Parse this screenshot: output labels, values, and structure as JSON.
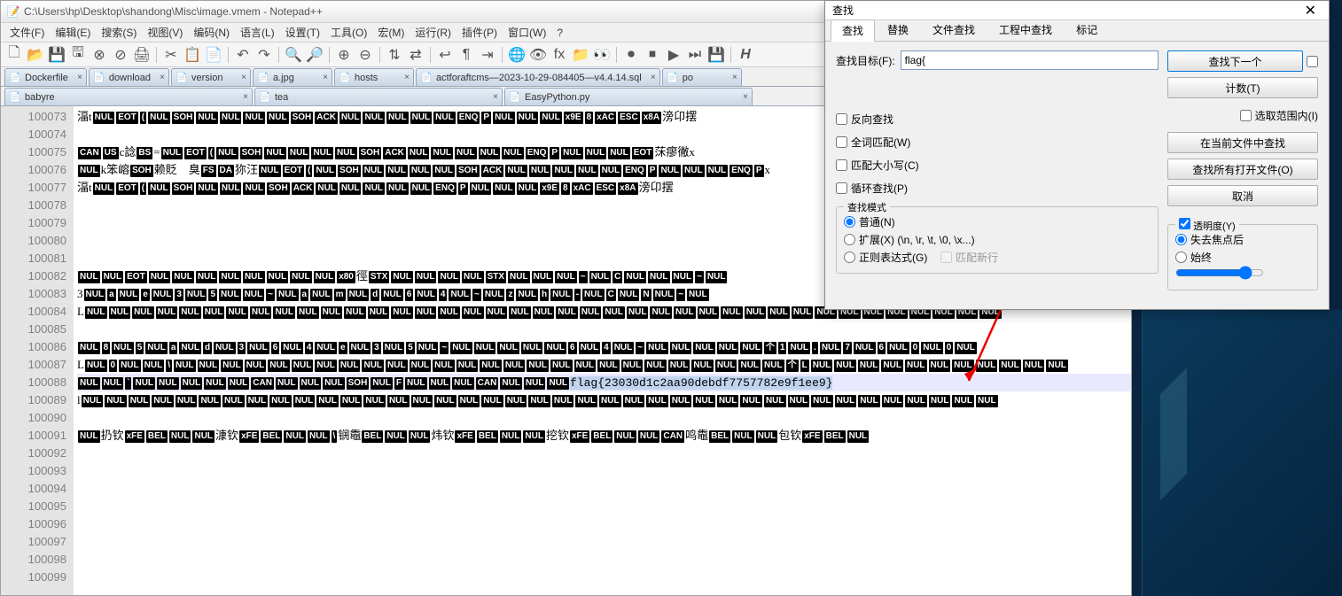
{
  "window": {
    "title": "C:\\Users\\hp\\Desktop\\shandong\\Misc\\image.vmem - Notepad++"
  },
  "menu": {
    "file": "文件(F)",
    "edit": "编辑(E)",
    "search": "搜索(S)",
    "view": "视图(V)",
    "encoding": "编码(N)",
    "language": "语言(L)",
    "settings": "设置(T)",
    "tools": "工具(O)",
    "macro": "宏(M)",
    "run": "运行(R)",
    "plugins": "插件(P)",
    "window": "窗口(W)",
    "help": "?"
  },
  "tabs1": [
    {
      "label": "Dockerfile"
    },
    {
      "label": "download"
    },
    {
      "label": "version"
    },
    {
      "label": "a.jpg"
    },
    {
      "label": "hosts"
    },
    {
      "label": "actforaftcms—2023-10-29-084405—v4.4.14.sql"
    },
    {
      "label": "po"
    }
  ],
  "tabs2": [
    {
      "label": "babyre"
    },
    {
      "label": "tea"
    },
    {
      "label": "EasyPython.py"
    }
  ],
  "gutter_start": 100073,
  "gutter_count": 27,
  "content_lines": {
    "0": {
      "pre": "湢t",
      "ctl": [
        "NUL",
        "EOT",
        "(",
        "NUL",
        "SOH",
        "NUL",
        "NUL",
        "NUL",
        "NUL",
        "SOH",
        "ACK",
        "NUL",
        "NUL",
        "NUL",
        "NUL",
        "NUL",
        "ENQ",
        "P",
        "NUL",
        "NUL",
        "NUL"
      ],
      "post": "滂",
      "ctl2": [
        "x9E",
        "8"
      ],
      "post2": "卬摆",
      "ctl3": [
        "xAC",
        "ESC",
        "x8A"
      ]
    },
    "2": {
      "pre": "",
      "ctl": [
        "CAN",
        "US"
      ],
      "mid": "c諗",
      "ctl2": [
        "BS"
      ],
      "mid2": "=",
      "ctl3": [
        "NUL",
        "EOT",
        "(",
        "NUL",
        "SOH",
        "NUL",
        "NUL",
        "NUL",
        "NUL",
        "SOH",
        "ACK",
        "NUL",
        "NUL",
        "NUL",
        "NUL",
        "NUL",
        "ENQ",
        "P",
        "NUL",
        "NUL",
        "NUL",
        "EOT"
      ],
      "post": "莯瘳徶x"
    },
    "3": {
      "pre": "",
      "ctl": [
        "NUL"
      ],
      "mid": "k笨嵱",
      "ctl2": [
        "SOH"
      ],
      "mid2": "赖貶　臭",
      "ctl3": [
        "FS",
        "DA"
      ],
      "mid3": "狝汪",
      "ctl4": [
        "NUL",
        "EOT",
        "(",
        "NUL",
        "SOH",
        "NUL",
        "NUL",
        "NUL",
        "NUL",
        "SOH",
        "ACK",
        "NUL",
        "NUL",
        "NUL",
        "NUL",
        "NUL",
        "ENQ",
        "P",
        "NUL",
        "NUL",
        "NUL",
        "ENQ",
        "P"
      ],
      "post": "x"
    },
    "4": {
      "pre": "湢t",
      "ctl": [
        "NUL",
        "EOT",
        "(",
        "NUL",
        "SOH",
        "NUL",
        "NUL",
        "NUL",
        "SOH",
        "ACK",
        "NUL",
        "NUL",
        "NUL",
        "NUL",
        "NUL",
        "ENQ",
        "P",
        "NUL",
        "NUL",
        "NUL"
      ],
      "post": "滂",
      "ctl2": [
        "x9E",
        "8"
      ],
      "post2": "卬摆",
      "ctl3": [
        "xAC",
        "ESC",
        "x8A"
      ]
    },
    "9": {
      "pre": "",
      "ctl": [
        "NUL",
        "NUL",
        "EOT",
        "NUL",
        "NUL",
        "NUL",
        "NUL",
        "NUL",
        "NUL",
        "NUL",
        "NUL",
        "x80"
      ],
      "mid": "徑",
      "ctl2": [
        "STX",
        "NUL",
        "NUL",
        "NUL",
        "NUL",
        "STX",
        "NUL",
        "NUL",
        "NUL",
        "~",
        "NUL",
        "C",
        "NUL",
        "NUL",
        "NUL",
        "~",
        "NUL"
      ]
    },
    "10": {
      "pre": "3",
      "ctl": [
        "NUL",
        "a",
        "NUL",
        "e",
        "NUL",
        "3",
        "NUL",
        "5",
        "NUL",
        "NUL",
        "~",
        "NUL",
        "a",
        "NUL",
        "m",
        "NUL",
        "d",
        "NUL",
        "6",
        "NUL",
        "4",
        "NUL",
        "~",
        "NUL",
        "z",
        "NUL",
        "h",
        "NUL",
        "-",
        "NUL",
        "C",
        "NUL",
        "N",
        "NUL",
        "~",
        "NUL"
      ]
    },
    "11": {
      "pre": "L",
      "ctl": [
        "NUL",
        "NUL",
        "NUL",
        "NUL",
        "NUL",
        "NUL",
        "NUL",
        "NUL",
        "NUL",
        "NUL",
        "NUL",
        "NUL",
        "NUL",
        "NUL",
        "NUL",
        "NUL",
        "NUL",
        "NUL",
        "NUL",
        "NUL",
        "NUL",
        "NUL",
        "NUL",
        "NUL",
        "NUL",
        "NUL",
        "NUL",
        "NUL",
        "NUL",
        "NUL",
        "NUL",
        "NUL",
        "NUL",
        "NUL",
        "NUL",
        "NUL",
        "NUL",
        "NUL",
        "NUL"
      ]
    },
    "13": {
      "pre": "",
      "ctl": [
        "NUL",
        "8",
        "NUL",
        "5",
        "NUL",
        "a",
        "NUL",
        "d",
        "NUL",
        "3",
        "NUL",
        "6",
        "NUL",
        "4",
        "NUL",
        "e",
        "NUL",
        "3",
        "NUL",
        "5",
        "NUL",
        "~",
        "NUL",
        "NUL",
        "NUL",
        "NUL",
        "NUL",
        "6",
        "NUL",
        "4",
        "NUL",
        "~",
        "NUL",
        "NUL",
        "NUL",
        "NUL",
        "NUL",
        "个",
        "1",
        "NUL",
        ".",
        "NUL",
        "7",
        "NUL",
        "6",
        "NUL",
        "0",
        "NUL",
        "0",
        "NUL"
      ]
    },
    "14": {
      "pre": "L",
      "ctl": [
        "NUL",
        "0",
        "NUL",
        "NUL",
        "\\",
        "NUL",
        "NUL",
        "NUL",
        "NUL",
        "NUL",
        "NUL",
        "NUL",
        "NUL",
        "NUL",
        "NUL",
        "NUL",
        "NUL",
        "NUL",
        "NUL",
        "NUL",
        "NUL",
        "NUL",
        "NUL",
        "NUL",
        "NUL",
        "NUL",
        "NUL",
        "NUL",
        "NUL",
        "NUL",
        "NUL",
        "个",
        "L",
        "NUL",
        "NUL",
        "NUL",
        "NUL",
        "NUL",
        "NUL",
        "NUL",
        "NUL",
        "NUL",
        "NUL",
        "NUL"
      ]
    },
    "15": {
      "pre": "",
      "ctl": [
        "NUL",
        "NUL",
        "`",
        "NUL",
        "NUL",
        "NUL",
        "NUL",
        "NUL",
        "CAN",
        "NUL",
        "NUL",
        "NUL",
        "SOH",
        "NUL",
        "F",
        "NUL",
        "NUL",
        "NUL",
        "CAN",
        "NUL",
        "NUL",
        "NUL"
      ],
      "flag": "flag{23030d1c2aa90debdf7757782e9f1ee9}"
    },
    "16": {
      "pre": "l",
      "ctl": [
        "NUL",
        "NUL",
        "NUL",
        "NUL",
        "NUL",
        "NUL",
        "NUL",
        "NUL",
        "NUL",
        "NUL",
        "NUL",
        "NUL",
        "NUL",
        "NUL",
        "NUL",
        "NUL",
        "NUL",
        "NUL",
        "NUL",
        "NUL",
        "NUL",
        "NUL",
        "NUL",
        "NUL",
        "NUL",
        "NUL",
        "NUL",
        "NUL",
        "NUL",
        "NUL",
        "NUL",
        "NUL",
        "NUL",
        "NUL",
        "NUL",
        "NUL",
        "NUL",
        "NUL",
        "NUL"
      ]
    },
    "18": {
      "pre": "",
      "ctl": [
        "NUL"
      ],
      "mid": "扔钦",
      "ctl2": [
        "xFE",
        "BEL",
        "NUL",
        "NUL"
      ],
      "mid2": "漮钦",
      "ctl3": [
        "xFE",
        "BEL",
        "NUL",
        "NUL",
        "\\"
      ],
      "mid3": "锎鼄",
      "ctl4": [
        "BEL",
        "NUL",
        "NUL"
      ],
      "mid4": "炜钦",
      "ctl5": [
        "xFE",
        "BEL",
        "NUL",
        "NUL"
      ],
      "mid5": "挖钦",
      "ctl6": [
        "xFE",
        "BEL",
        "NUL",
        "NUL",
        "CAN"
      ],
      "mid6": "鸣鼄",
      "ctl7": [
        "BEL",
        "NUL",
        "NUL"
      ],
      "mid7": "包钦",
      "ctl8": [
        "xFE",
        "BEL",
        "NUL"
      ]
    }
  },
  "find": {
    "title": "查找",
    "tabs": {
      "find": "查找",
      "replace": "替换",
      "findfiles": "文件查找",
      "findproj": "工程中查找",
      "mark": "标记"
    },
    "target_label": "查找目标(F):",
    "target_value": "flag{",
    "btn_next": "查找下一个",
    "btn_count": "计数(T)",
    "btn_selscope": "选取范围内(I)",
    "btn_allcurrent": "在当前文件中查找",
    "btn_allopen": "查找所有打开文件(O)",
    "btn_cancel": "取消",
    "chk_reverse": "反向查找",
    "chk_wholeword": "全词匹配(W)",
    "chk_case": "匹配大小写(C)",
    "chk_wrap": "循环查找(P)",
    "grp_mode": "查找模式",
    "rad_normal": "普通(N)",
    "rad_ext": "扩展(X) (\\n, \\r, \\t, \\0, \\x...)",
    "rad_regex": "正则表达式(G)",
    "chk_newline": "匹配新行",
    "grp_trans": "透明度(Y)",
    "rad_lostfocus": "失去焦点后",
    "rad_always": "始终"
  }
}
